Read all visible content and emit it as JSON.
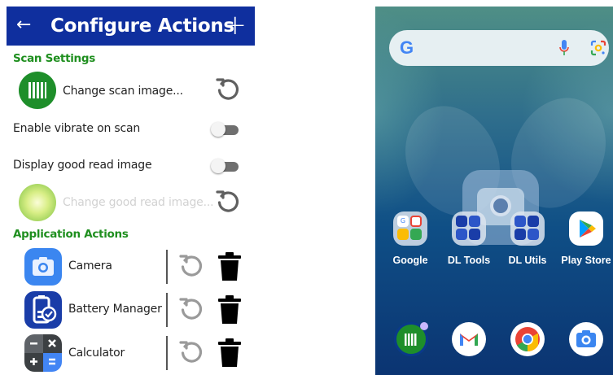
{
  "config_screen": {
    "header": {
      "back_icon": "arrow-left-icon",
      "title": "Configure Actions",
      "add_icon": "plus-icon"
    },
    "scan_settings": {
      "heading": "Scan Settings",
      "change_scan_image": "Change scan image...",
      "enable_vibrate": {
        "label": "Enable vibrate on scan",
        "on": false
      },
      "display_good_read": {
        "label": "Display good read image",
        "on": false
      },
      "change_good_read_image": "Change good read image..."
    },
    "application_actions": {
      "heading": "Application Actions",
      "items": [
        {
          "label": "Camera",
          "icon": "camera-icon"
        },
        {
          "label": "Battery Manager",
          "icon": "battery-manager-icon"
        },
        {
          "label": "Calculator",
          "icon": "calculator-icon"
        }
      ]
    },
    "colors": {
      "header": "#0f2f9e",
      "section": "#1f8f1f",
      "scan_icon": "#1e8e2a"
    }
  },
  "home_screen": {
    "search_bar": {
      "logo": "G",
      "mic_icon": "mic-icon",
      "lens_icon": "google-lens-icon"
    },
    "widget_icon": "camera-widget-icon",
    "apps": [
      {
        "label": "Google",
        "icon": "google-folder-icon"
      },
      {
        "label": "DL Tools",
        "icon": "dl-tools-folder-icon"
      },
      {
        "label": "DL Utils",
        "icon": "dl-utils-folder-icon"
      },
      {
        "label": "Play Store",
        "icon": "play-store-icon"
      }
    ],
    "dock": [
      "scan-app-icon",
      "gmail-icon",
      "chrome-icon",
      "camera-icon"
    ]
  }
}
